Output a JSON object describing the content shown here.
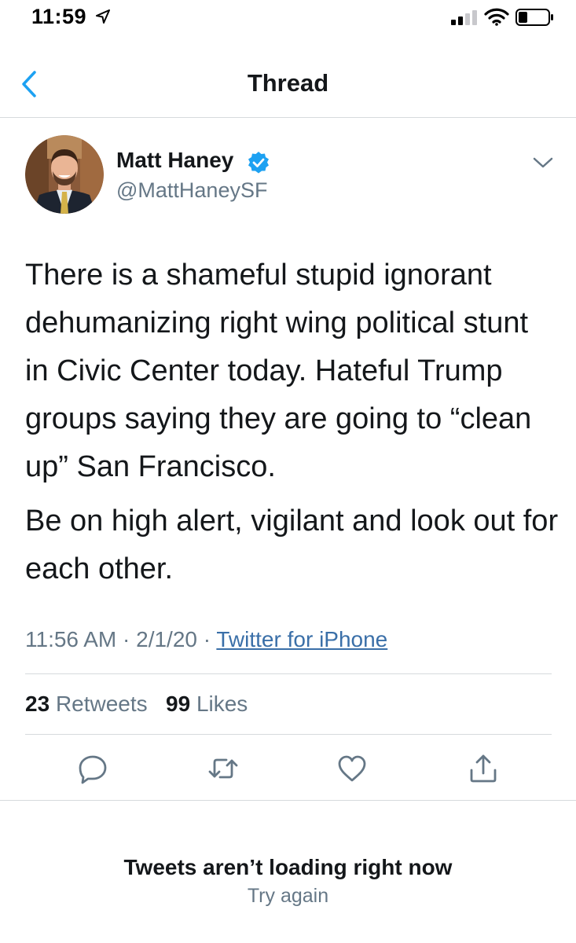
{
  "status_bar": {
    "time": "11:59",
    "icons": [
      "location-arrow-icon",
      "cellular-signal-icon",
      "wifi-icon",
      "battery-icon"
    ]
  },
  "header": {
    "title": "Thread",
    "back_icon": "chevron-left-icon"
  },
  "tweet": {
    "author": {
      "name": "Matt Haney",
      "handle": "@MattHaneySF",
      "verified": true
    },
    "paragraphs": [
      "There is a shameful stupid ignorant dehumanizing right wing political stunt in Civic Center today.  Hateful Trump groups saying they are going to “clean up” San Francisco.",
      "Be on high alert, vigilant and look out for each other."
    ],
    "time": "11:56 AM",
    "separator": "·",
    "date": "2/1/20",
    "source": "Twitter for iPhone",
    "retweets_count": "23",
    "retweets_label": "Retweets",
    "likes_count": "99",
    "likes_label": "Likes",
    "actions": [
      "reply-icon",
      "retweet-icon",
      "like-icon",
      "share-icon"
    ]
  },
  "empty_state": {
    "title": "Tweets aren’t loading right now",
    "retry_label": "Try again"
  },
  "colors": {
    "accent": "#1da1f2",
    "text": "#14171a",
    "secondary": "#657786",
    "divider": "#d6dadd"
  }
}
